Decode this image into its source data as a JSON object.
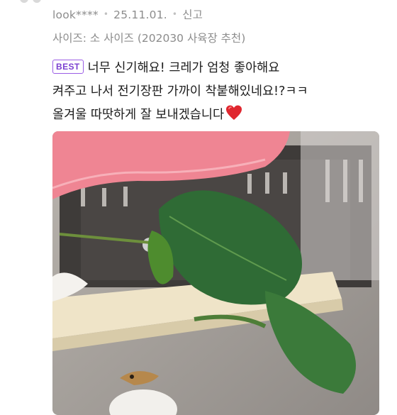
{
  "review": {
    "author": "look****",
    "date": "25.11.01.",
    "report_label": "신고",
    "option_text": "사이즈: 소 사이즈 (202030 사육장 추천)",
    "badge": "BEST",
    "lines": [
      "너무 신기해요! 크레가 엄청 좋아해요",
      "켜주고 나서 전기장판 가까이 착붙해있네요!?ㅋㅋ",
      "올겨울 따땃하게 잘 보내겠습니다"
    ],
    "emoji": "heart-emoji",
    "photo_icon": "review-photo"
  },
  "colors": {
    "badge_border": "#9b5de5",
    "meta_text": "#8c8c8c",
    "heart": "#e0272f"
  }
}
